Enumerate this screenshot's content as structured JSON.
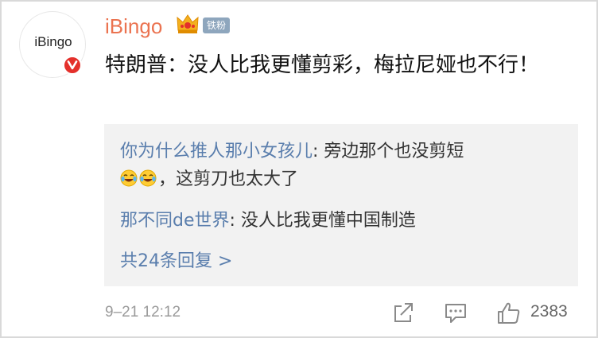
{
  "avatar": {
    "text": "iBingo"
  },
  "user": {
    "name": "iBingo",
    "fan_badge": "铁粉"
  },
  "post": {
    "text": "特朗普：没人比我更懂剪彩，梅拉尼娅也不行！"
  },
  "replies": [
    {
      "author": "你为什么推人那小女孩儿",
      "sep": ": ",
      "text_before_emoji": "旁边那个也没剪短",
      "emoji": [
        "laugh-cry-icon",
        "laugh-cry-icon"
      ],
      "text_after_emoji": "，这剪刀也太大了"
    },
    {
      "author": "那不同de世界",
      "sep": ": ",
      "text": "没人比我更懂中国制造"
    }
  ],
  "more_replies": "共24条回复 >",
  "footer": {
    "timestamp": "9–21 12:12",
    "like_count": "2383"
  },
  "colors": {
    "username": "#eb7350",
    "link": "#5a7ead",
    "verified": "#e4302b",
    "reply_bg": "#f2f2f2"
  }
}
